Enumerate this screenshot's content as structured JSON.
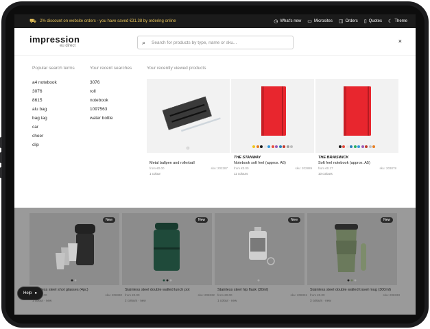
{
  "topbar": {
    "promo": "2% discount on website orders - you have saved €31.38 by ordering online",
    "links": [
      "What's new",
      "Microsites",
      "Orders",
      "Quotes",
      "Theme"
    ]
  },
  "header": {
    "logo_main": "impression",
    "logo_sub": "eu direct",
    "search_placeholder": "Search for products by type, name or sku...",
    "close": "×"
  },
  "panel": {
    "popular_title": "Popular search terms",
    "popular": [
      "a4 notebook",
      "3076",
      "8615",
      "alu bag",
      "bag tag",
      "car",
      "cheer",
      "clip"
    ],
    "recent_title": "Your recent searches",
    "recent": [
      "3076",
      "roll",
      "notebook",
      "1097563",
      "water bottle"
    ],
    "viewed_title": "Your recently viewed products",
    "viewed": [
      {
        "brand": "",
        "name": "Metal ballpen and rollerball",
        "from": "from €0.00",
        "sku": "sku: 202287",
        "colours": "1 colour"
      },
      {
        "brand": "THE STANWAY",
        "name": "Notebook soft feel (approx. A6)",
        "from": "from €0.00",
        "sku": "sku: 202889",
        "colours": "11 colours"
      },
      {
        "brand": "THE BRAISWICK",
        "name": "Soft feel notebook (approx. A5)",
        "from": "from €0.17",
        "sku": "sku: 203078",
        "colours": "10 colours"
      }
    ],
    "swatches2": [
      "#f0c419",
      "#e67e22",
      "#1a1a1a",
      "#e8e8e8",
      "#3498db",
      "#e74c3c",
      "#9b59b6",
      "#2980b9",
      "#c0392b",
      "#a0a0a0",
      "#bfbfbf"
    ],
    "swatches3": [
      "#1a1a1a",
      "#e74c3c",
      "#e8e8e8",
      "#2980b9",
      "#27ae60",
      "#3498db",
      "#9b59b6",
      "#c0392b",
      "#bdc3c7",
      "#e67e22"
    ]
  },
  "grid": [
    {
      "name": "Stainless steel shot glasses (4pc)",
      "from": "from €0.00",
      "sku": "sku: 208330",
      "colours": "1 colour · new",
      "badge": "New"
    },
    {
      "name": "Stainless steel double walled lunch pot",
      "from": "from €0.00",
      "sku": "sku: 208332",
      "colours": "2 colours · new",
      "badge": "New"
    },
    {
      "name": "Stainless steel hip flask (30ml)",
      "from": "from €0.00",
      "sku": "sku: 208331",
      "colours": "1 colour · new",
      "badge": "New"
    },
    {
      "name": "Stainless steel double walled travel mug (300ml)",
      "from": "from €0.00",
      "sku": "sku: 208333",
      "colours": "3 colours · new",
      "badge": "New"
    }
  ],
  "help": {
    "label": "Help"
  }
}
